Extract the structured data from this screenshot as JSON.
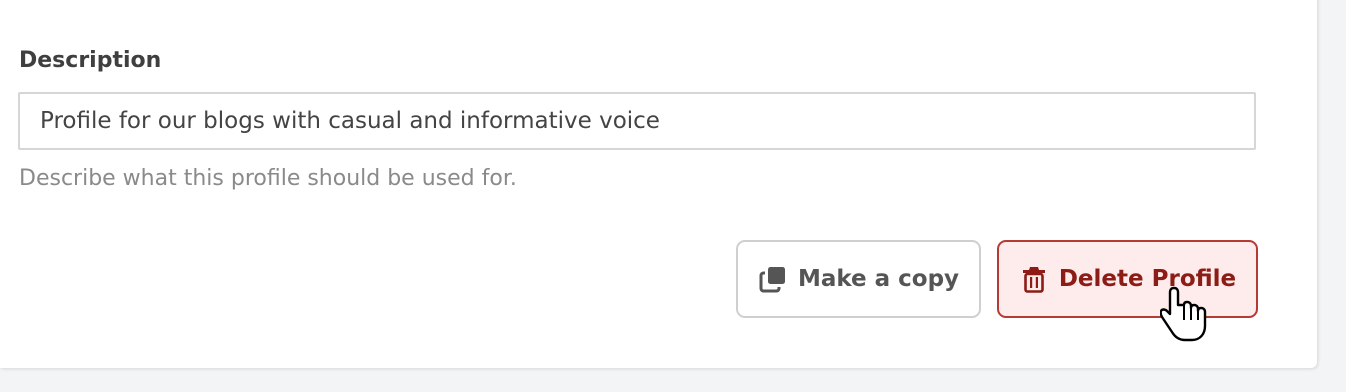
{
  "description_field": {
    "label": "Description",
    "value": "Profile for our blogs with casual and informative voice",
    "help_text": "Describe what this profile should be used for."
  },
  "actions": {
    "copy_label": "Make a copy",
    "copy_icon": "copy-icon",
    "delete_label": "Delete Profile",
    "delete_icon": "trash-icon"
  },
  "colors": {
    "delete_text": "#8c1c15",
    "delete_border": "#b53a33",
    "delete_bg": "#fdeceb"
  }
}
